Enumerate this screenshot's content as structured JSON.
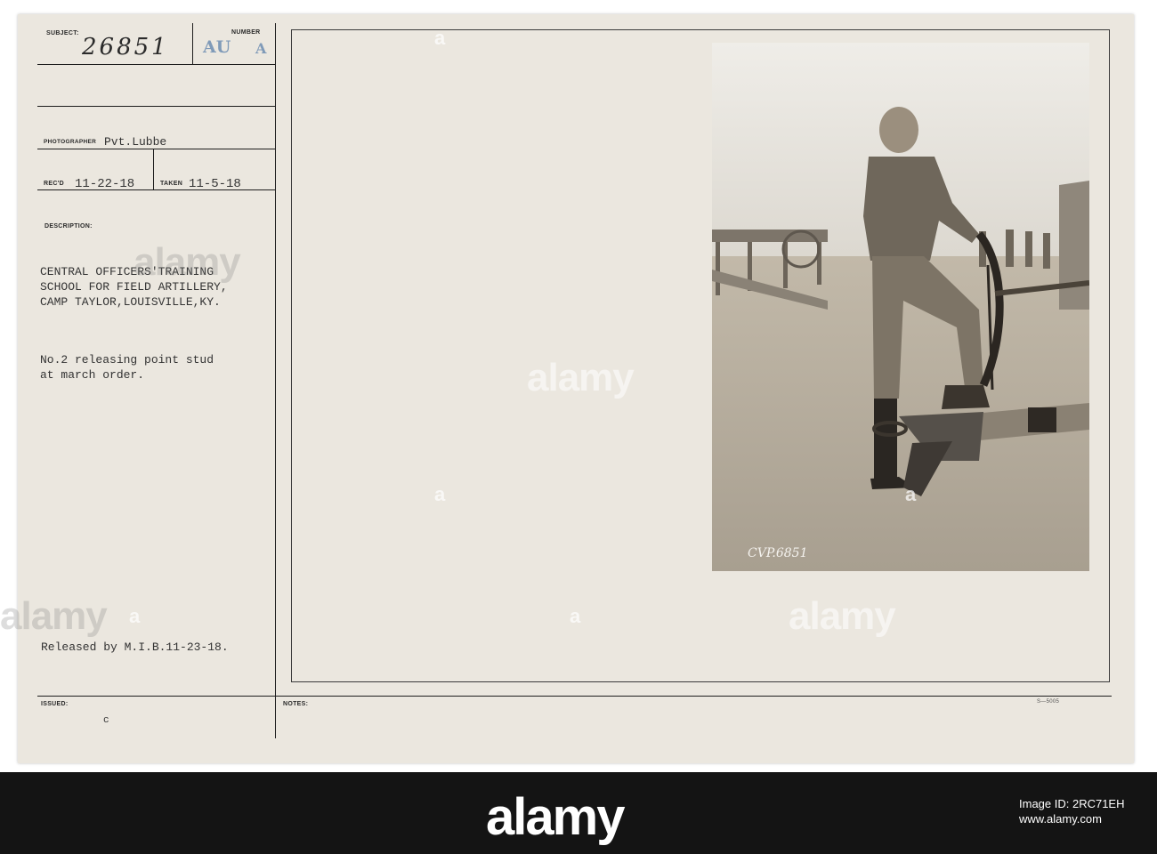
{
  "labels": {
    "subject": "SUBJECT:",
    "number": "NUMBER",
    "photographer": "PHOTOGRAPHER",
    "recd": "REC'D",
    "taken": "TAKEN",
    "description": "DESCRIPTION:",
    "issued": "ISSUED:",
    "notes": "NOTES:"
  },
  "record": {
    "subject_number": "26851",
    "number_code": "AU",
    "number_stamp": "A",
    "photographer": "Pvt.Lubbe",
    "received": "11-22-18",
    "taken": "11-5-18",
    "description_line1": "CENTRAL OFFICERS'TRAINING",
    "description_line2": "SCHOOL FOR FIELD ARTILLERY,",
    "description_line3": "CAMP TAYLOR,LOUISVILLE,KY.",
    "caption_line1": "No.2 releasing point stud",
    "caption_line2": "at march order.",
    "released": "Released by M.I.B.11-23-18.",
    "issued_mark": "c",
    "form_code": "S—5005",
    "negative_mark": "CVP.6851"
  },
  "watermark": {
    "brand": "alamy",
    "letter": "a"
  },
  "footer": {
    "brand": "alamy",
    "id_line1": "Image ID: 2RC71EH",
    "id_line2": "www.alamy.com"
  },
  "colors": {
    "card": "#ebe7df",
    "ink": "#1d1d1d",
    "stamp": "#7f9ab8",
    "footer": "#141414"
  }
}
